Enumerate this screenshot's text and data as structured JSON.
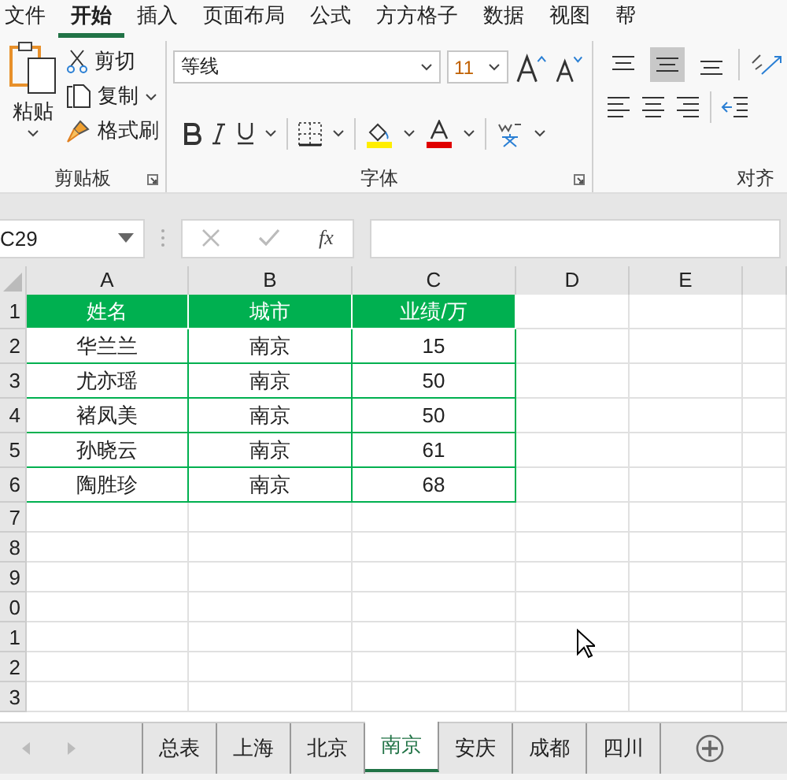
{
  "menu_tabs": [
    {
      "label": "文件",
      "selected": false
    },
    {
      "label": "开始",
      "selected": true
    },
    {
      "label": "插入",
      "selected": false
    },
    {
      "label": "页面布局",
      "selected": false
    },
    {
      "label": "公式",
      "selected": false
    },
    {
      "label": "方方格子",
      "selected": false
    },
    {
      "label": "数据",
      "selected": false
    },
    {
      "label": "视图",
      "selected": false
    },
    {
      "label": "帮",
      "selected": false
    }
  ],
  "clipboard": {
    "paste_label": "粘贴",
    "commands": [
      "剪切",
      "复制",
      "格式刷"
    ],
    "group_label": "剪贴板"
  },
  "font": {
    "font_name": "等线",
    "font_size": "11",
    "group_label": "字体"
  },
  "alignment": {
    "vertical": [
      {
        "selected": false
      },
      {
        "selected": true
      },
      {
        "selected": false
      }
    ],
    "group_label": "对齐"
  },
  "formula_bar": {
    "name_box": "C29",
    "fx": "fx"
  },
  "columns": [
    "A",
    "B",
    "C",
    "D",
    "E"
  ],
  "row_headers": [
    "1",
    "2",
    "3",
    "4",
    "5",
    "6",
    "7",
    "8",
    "9",
    "0",
    "1",
    "2",
    "3"
  ],
  "table": {
    "header": [
      "姓名",
      "城市",
      "业绩/万"
    ],
    "rows": [
      [
        "华兰兰",
        "南京",
        "15"
      ],
      [
        "尤亦瑶",
        "南京",
        "50"
      ],
      [
        "褚凤美",
        "南京",
        "50"
      ],
      [
        "孙晓云",
        "南京",
        "61"
      ],
      [
        "陶胜珍",
        "南京",
        "68"
      ]
    ]
  },
  "sheet_tabs": [
    {
      "label": "总表",
      "selected": false
    },
    {
      "label": "上海",
      "selected": false
    },
    {
      "label": "北京",
      "selected": false
    },
    {
      "label": "南京",
      "selected": true
    },
    {
      "label": "安庆",
      "selected": false
    },
    {
      "label": "成都",
      "selected": false
    },
    {
      "label": "四川",
      "selected": false
    }
  ]
}
